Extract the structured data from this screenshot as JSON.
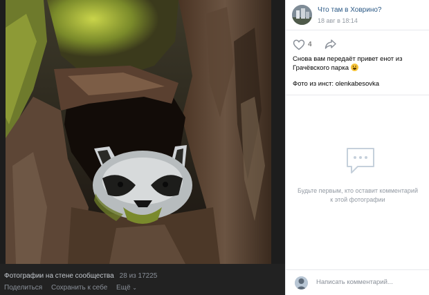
{
  "photo": {
    "alt": "Raccoon face carved into an old tree trunk",
    "subject": "raccoon-wood-carving"
  },
  "footer": {
    "album_label": "Фотографии на стене сообщества",
    "counter": "28 из 17225",
    "share_label": "Поделиться",
    "save_label": "Сохранить к себе",
    "more_label": "Ещё"
  },
  "post": {
    "group_name": "Что там в Ховрино?",
    "date": "18 авг в 18:14",
    "likes": "4",
    "text": "Снова вам передаёт привет енот из Грачёвского парка",
    "emoji": "smile-emoji",
    "source": "Фото из инст: olenkabesovka"
  },
  "comments": {
    "empty_text": "Будьте первым, кто оставит комментарий к этой фотографии",
    "placeholder": "Написать комментарий..."
  },
  "colors": {
    "link": "#2a5885",
    "muted": "#939aa3",
    "dark_bg": "#1d1d1d"
  }
}
